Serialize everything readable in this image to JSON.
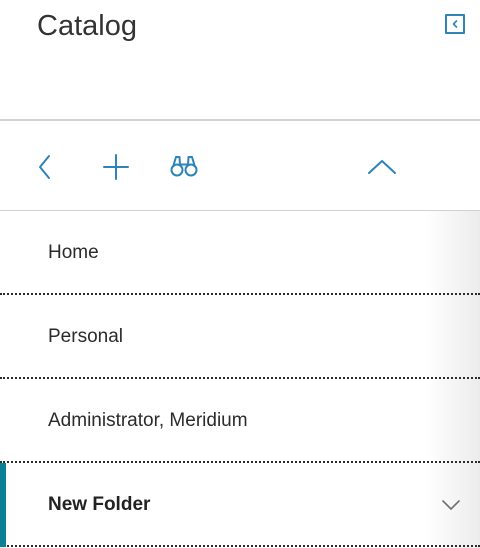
{
  "panel": {
    "title": "Catalog",
    "collapse_icon": "collapse-left-icon"
  },
  "toolbar": {
    "tools": [
      {
        "name": "back",
        "icon": "chevron-left-icon"
      },
      {
        "name": "add",
        "icon": "plus-icon"
      },
      {
        "name": "search",
        "icon": "binoculars-icon"
      },
      {
        "name": "collapse-up",
        "icon": "chevron-up-icon"
      }
    ],
    "icon_color": "#2e83b8"
  },
  "list": {
    "items": [
      {
        "label": "Home",
        "active": false
      },
      {
        "label": "Personal",
        "active": false
      },
      {
        "label": "Administrator, Meridium",
        "active": false
      },
      {
        "label": "New Folder",
        "active": true,
        "expandable": true
      }
    ],
    "active_color": "#0c7f97"
  }
}
